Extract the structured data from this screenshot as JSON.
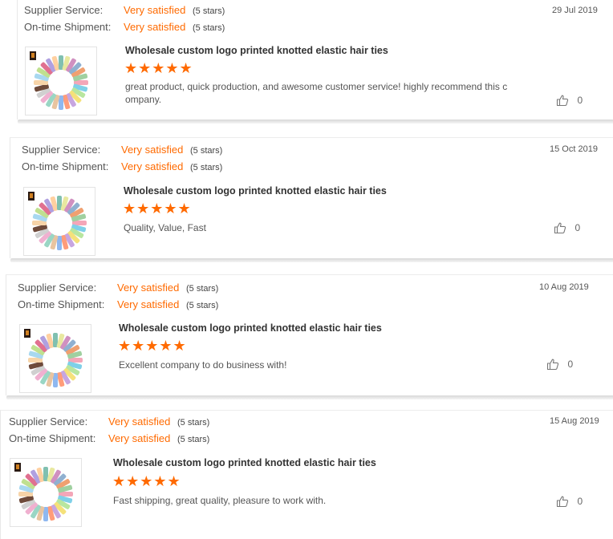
{
  "labels": {
    "supplier_service": "Supplier Service:",
    "on_time_shipment": "On-time Shipment:"
  },
  "colors": {
    "accent": "#ff6a00",
    "divider": "#e8e8e8"
  },
  "icons": {
    "like": "thumbs-up-icon",
    "star": "star-icon",
    "logo": "seller-logo-icon"
  },
  "reviews": [
    {
      "supplier_value": "Very satisfied",
      "supplier_stars": "(5 stars)",
      "shipment_value": "Very satisfied",
      "shipment_stars": "(5 stars)",
      "date": "29 Jul 2019",
      "product_title": "Wholesale custom logo printed knotted elastic hair ties",
      "rating": 5,
      "rating_stars": "★★★★★",
      "text": "great product, quick production, and awesome customer service! highly recommend this company.",
      "likes": "0"
    },
    {
      "supplier_value": "Very satisfied",
      "supplier_stars": "(5 stars)",
      "shipment_value": "Very satisfied",
      "shipment_stars": "(5 stars)",
      "date": "15 Oct 2019",
      "product_title": "Wholesale custom logo printed knotted elastic hair ties",
      "rating": 5,
      "rating_stars": "★★★★★",
      "text": "Quality, Value, Fast",
      "likes": "0"
    },
    {
      "supplier_value": "Very satisfied",
      "supplier_stars": "(5 stars)",
      "shipment_value": "Very satisfied",
      "shipment_stars": "(5 stars)",
      "date": "10 Aug 2019",
      "product_title": "Wholesale custom logo printed knotted elastic hair ties",
      "rating": 5,
      "rating_stars": "★★★★★",
      "text": "Excellent company to do business with!",
      "likes": "0"
    },
    {
      "supplier_value": "Very satisfied",
      "supplier_stars": "(5 stars)",
      "shipment_value": "Very satisfied",
      "shipment_stars": "(5 stars)",
      "date": "15 Aug 2019",
      "product_title": "Wholesale custom logo printed knotted elastic hair ties",
      "rating": 5,
      "rating_stars": "★★★★★",
      "text": "Fast shipping, great quality, pleasure to work with.",
      "likes": "0"
    }
  ]
}
